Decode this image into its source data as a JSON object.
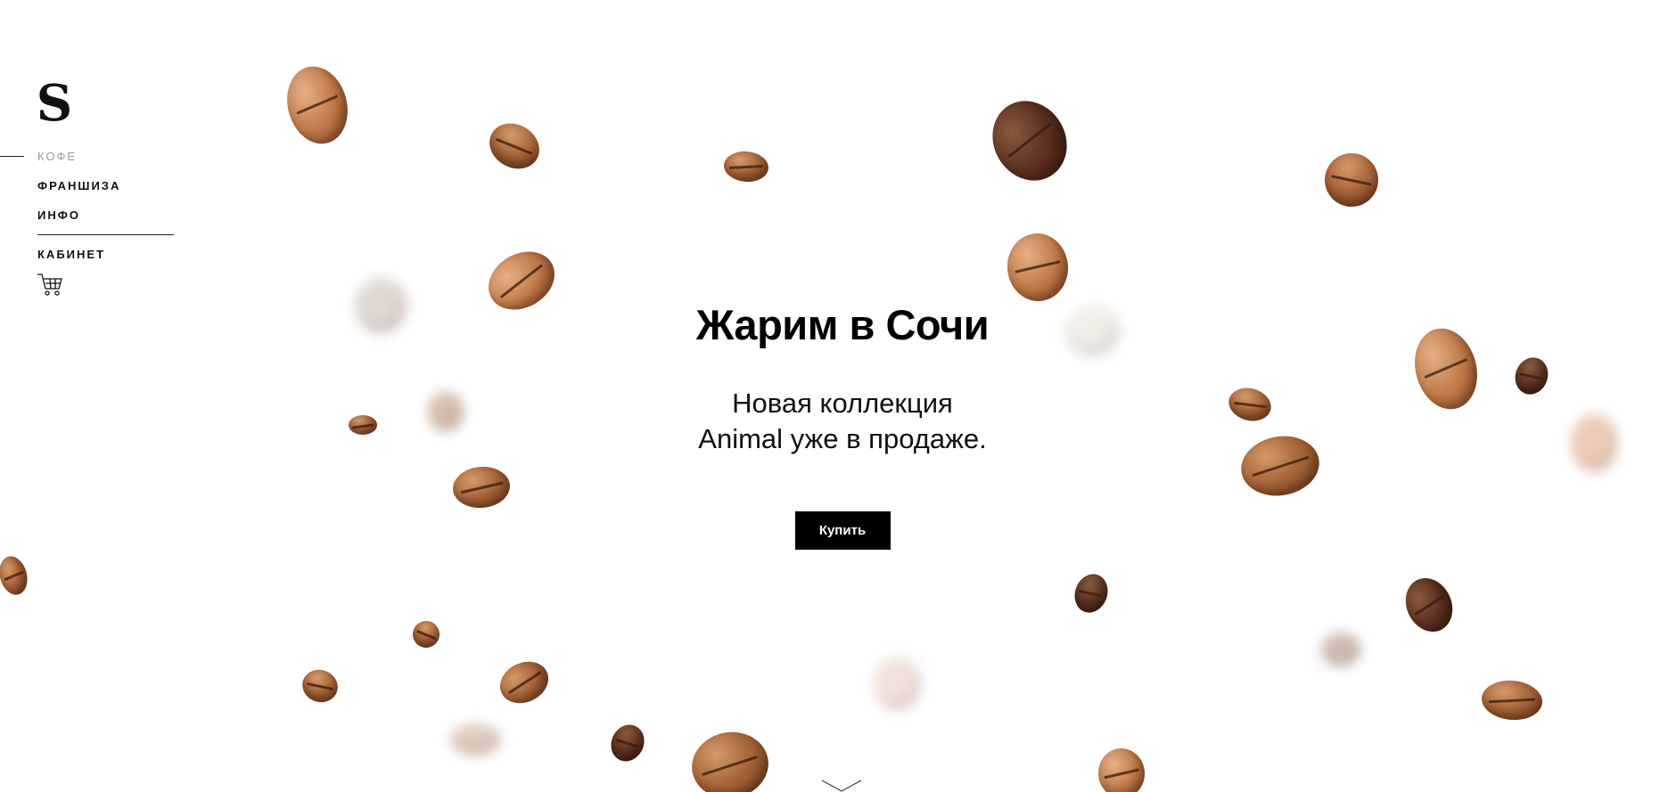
{
  "sidebar": {
    "logo_text": "S",
    "nav": [
      {
        "label": "КОФЕ",
        "active": true
      },
      {
        "label": "ФРАНШИЗА",
        "active": false
      },
      {
        "label": "ИНФО",
        "active": false
      }
    ],
    "cabinet_label": "КАБИНЕТ",
    "cart_icon": "cart-icon"
  },
  "hero": {
    "title": "Жарим в Сочи",
    "subtitle_line1": "Новая коллекция",
    "subtitle_line2": "Animal уже в продаже.",
    "buy_label": "Купить"
  },
  "scroll_icon": "chevron-down-icon",
  "colors": {
    "background": "#ffffff",
    "text": "#000000",
    "nav_active": "#9a9a9a",
    "button_bg": "#000000",
    "button_text": "#ffffff",
    "bean": "#a9663a"
  }
}
